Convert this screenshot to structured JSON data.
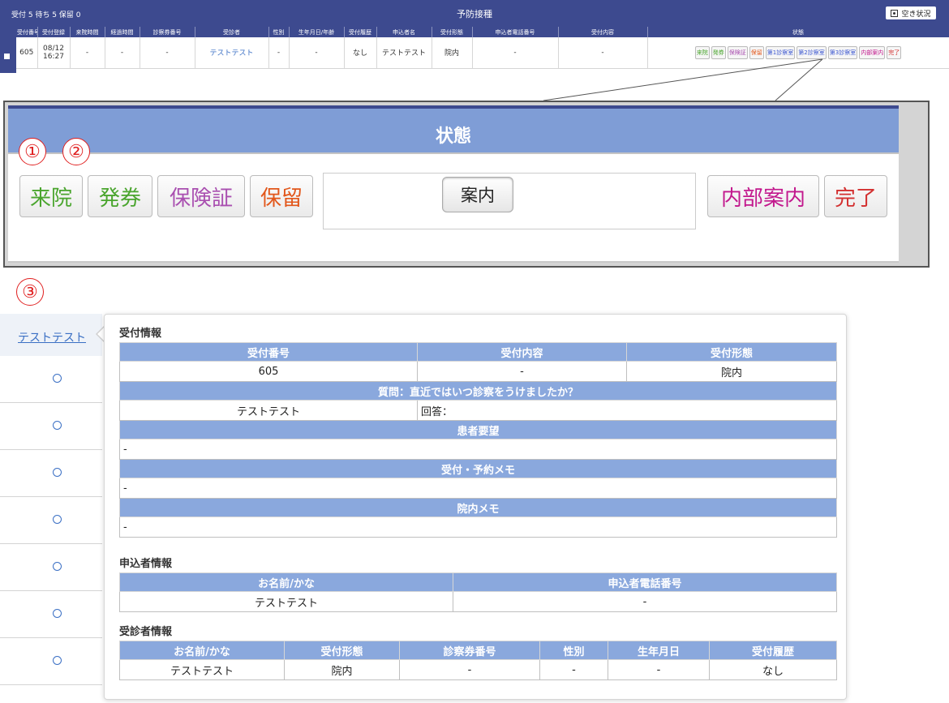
{
  "topbar": {
    "counts": "受付 5 待ち 5 保留 0",
    "title": "予防接種",
    "availability_button": "空き状況"
  },
  "table": {
    "headers": [
      "受付番号",
      "受付登録",
      "来院時間",
      "経過時間",
      "診察券番号",
      "受診者",
      "性別",
      "生年月日/年齢",
      "受付履歴",
      "申込者名",
      "受付形態",
      "申込者電話番号",
      "受付内容",
      "状態"
    ],
    "row": {
      "number": "605",
      "date": "08/12",
      "time": "16:27",
      "arrival": "-",
      "elapsed": "-",
      "card": "-",
      "patient": "テストテスト",
      "sex": "-",
      "birth": "-",
      "history": "なし",
      "applicant": "テストテスト",
      "form": "院内",
      "phone": "-",
      "content": "-"
    },
    "status_buttons": [
      "来院",
      "発券",
      "保険証",
      "保留",
      "第1診察室",
      "第2診察室",
      "第3診察室",
      "内部案内",
      "完了"
    ]
  },
  "zoom": {
    "header": "状態",
    "buttons": {
      "arrive": "来院",
      "ticket": "発券",
      "insurance": "保険証",
      "hold": "保留",
      "guide": "案内",
      "internal_guide": "内部案内",
      "complete": "完了"
    },
    "markers": [
      "①",
      "②",
      "③"
    ]
  },
  "leftlist": {
    "patient_link": "テストテスト",
    "row_count": 8
  },
  "popover": {
    "reception_title": "受付情報",
    "reception_headers": [
      "受付番号",
      "受付内容",
      "受付形態"
    ],
    "reception_values": [
      "605",
      "-",
      "院内"
    ],
    "question_header": "質問：直近ではいつ診察をうけましたか？",
    "question_name": "テストテスト",
    "answer_label": "回答：",
    "request_header": "患者要望",
    "request_value": "-",
    "memo_header": "受付・予約メモ",
    "memo_value": "-",
    "hospital_memo_header": "院内メモ",
    "hospital_memo_value": "-",
    "applicant_title": "申込者情報",
    "applicant_headers": [
      "お名前/かな",
      "申込者電話番号"
    ],
    "applicant_values": [
      "テストテスト",
      "-"
    ],
    "patient_title": "受診者情報",
    "patient_headers": [
      "お名前/かな",
      "受付形態",
      "診察券番号",
      "性別",
      "生年月日",
      "受付履歴"
    ],
    "patient_values": [
      "テストテスト",
      "院内",
      "-",
      "-",
      "-",
      "なし"
    ]
  },
  "colors": {
    "navy": "#3d4a8f",
    "header_blue": "#8aa8dd",
    "link_blue": "#3a6fc4",
    "marker_red": "#e02020"
  }
}
